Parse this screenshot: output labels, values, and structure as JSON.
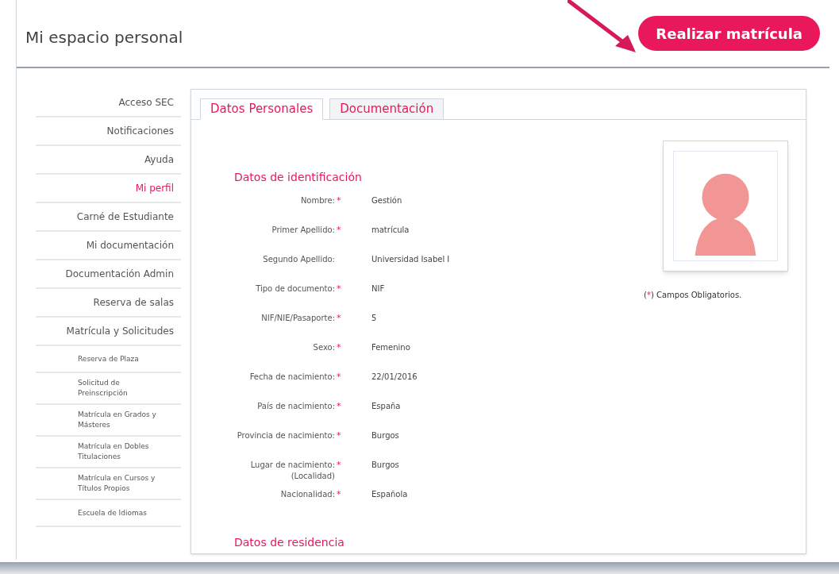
{
  "header": {
    "title": "Mi espacio personal",
    "action_button": "Realizar matrícula"
  },
  "sidebar": {
    "items": [
      {
        "label": "Acceso SEC",
        "selected": false
      },
      {
        "label": "Notificaciones",
        "selected": false
      },
      {
        "label": "Ayuda",
        "selected": false
      },
      {
        "label": "Mi perfil",
        "selected": true
      },
      {
        "label": "Carné de Estudiante",
        "selected": false
      },
      {
        "label": "Mi documentación",
        "selected": false
      },
      {
        "label": "Documentación Admin",
        "selected": false
      },
      {
        "label": "Reserva de salas",
        "selected": false
      },
      {
        "label": "Matrícula y Solicitudes",
        "selected": false,
        "children": [
          {
            "label": "Reserva de Plaza",
            "selected": false
          },
          {
            "label": "Solicitud de Preinscripción",
            "selected": false
          },
          {
            "label": "Matrícula en Grados y Másteres",
            "selected": false
          },
          {
            "label": "Matrícula en Dobles Titulaciones",
            "selected": false
          },
          {
            "label": "Matrícula en Cursos y Títulos Propios",
            "selected": false
          },
          {
            "label": "Escuela de Idiomas",
            "selected": false
          }
        ]
      }
    ]
  },
  "tabs": [
    {
      "label": "Datos Personales",
      "selected": true
    },
    {
      "label": "Documentación",
      "selected": false
    }
  ],
  "form": {
    "section_title": "Datos de identificación",
    "fields": [
      {
        "label": "Nombre:",
        "required": true,
        "value": "Gestión"
      },
      {
        "label": "Primer Apellido:",
        "required": true,
        "value": "matrícula"
      },
      {
        "label": "Segundo Apellido:",
        "required": false,
        "value": "Universidad Isabel I"
      },
      {
        "label": "Tipo de documento:",
        "required": true,
        "value": "NIF"
      },
      {
        "label": "NIF/NIE/Pasaporte:",
        "required": true,
        "value": "5"
      },
      {
        "label": "Sexo:",
        "required": true,
        "value": "Femenino"
      },
      {
        "label": "Fecha de nacimiento:",
        "required": true,
        "value": "22/01/2016"
      },
      {
        "label": "País de nacimiento:",
        "required": true,
        "value": "España"
      },
      {
        "label": "Provincia de nacimiento:",
        "required": true,
        "value": "Burgos"
      },
      {
        "label": "Lugar de nacimiento: (Localidad)",
        "required": true,
        "value": "Burgos"
      },
      {
        "label": "Nacionalidad:",
        "required": true,
        "value": "Española"
      }
    ],
    "next_section_title": "Datos de residencia",
    "required_marker": "*",
    "required_note": {
      "open": "(",
      "mark": "*",
      "text": ") Campos Obligatorios."
    }
  }
}
